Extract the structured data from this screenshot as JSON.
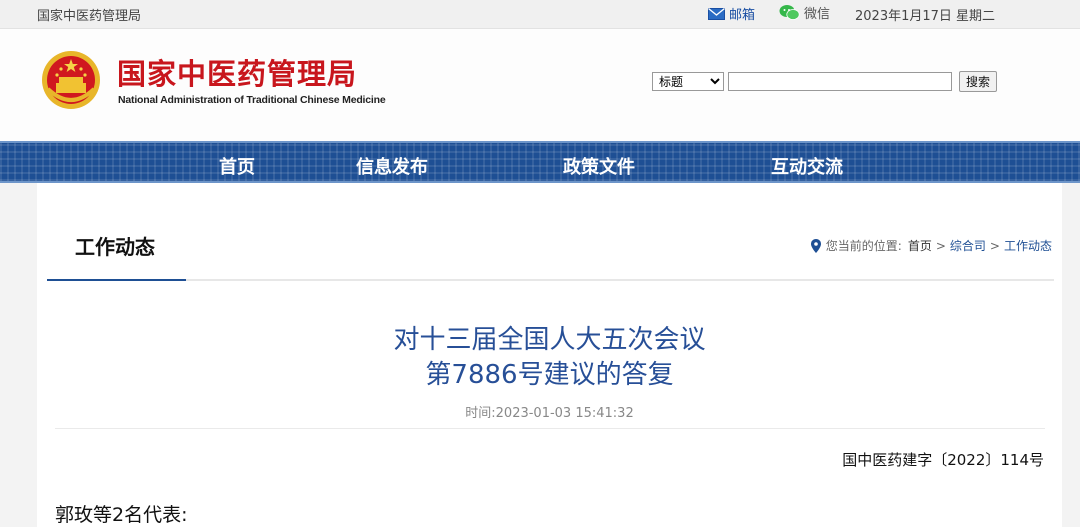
{
  "topbar": {
    "site_name": "国家中医药管理局",
    "mail_label": "邮箱",
    "wechat_label": "微信",
    "date": "2023年1月17日 星期二"
  },
  "header": {
    "logo_cn": "国家中医药管理局",
    "logo_en": "National Administration of Traditional Chinese Medicine",
    "search_select_value": "标题",
    "search_input_value": "",
    "search_button": "搜索"
  },
  "nav": {
    "items": [
      "首页",
      "信息发布",
      "政策文件",
      "互动交流"
    ]
  },
  "section": {
    "title": "工作动态",
    "crumb_prefix": "您当前的位置:",
    "crumbs": [
      "首页",
      "综合司",
      "工作动态"
    ],
    "crumb_sep": ">"
  },
  "article": {
    "title_line1": "对十三届全国人大五次会议",
    "title_line2": "第7886号建议的答复",
    "time": "时间:2023-01-03 15:41:32",
    "doc_number": "国中医药建字〔2022〕114号",
    "salutation": "郭玫等2名代表:"
  },
  "colors": {
    "brand_red": "#c8161d",
    "nav_blue": "#1e4f94",
    "title_blue": "#274f97"
  }
}
